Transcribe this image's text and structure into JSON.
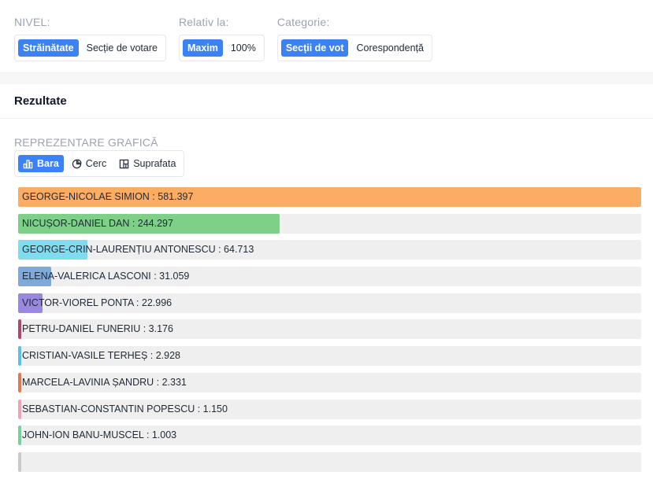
{
  "filters": [
    {
      "label": "NIVEL:",
      "options": [
        "Străinătate",
        "Secție de votare"
      ],
      "active": 0
    },
    {
      "label": "Relativ la:",
      "options": [
        "Maxim",
        "100%"
      ],
      "active": 0
    },
    {
      "label": "Categorie:",
      "options": [
        "Secții de vot",
        "Corespondență"
      ],
      "active": 0
    }
  ],
  "results": {
    "title": "Rezultate"
  },
  "viz": {
    "label": "REPREZENTARE GRAFICĂ",
    "options": [
      {
        "label": "Bara",
        "icon": "bar-chart-icon"
      },
      {
        "label": "Cerc",
        "icon": "pie-chart-icon"
      },
      {
        "label": "Suprafata",
        "icon": "treemap-icon"
      }
    ],
    "active": 0
  },
  "candidates": [
    {
      "label": "GEORGE-NICOLAE SIMION : 581.397",
      "votes": 581397,
      "color": "#fbad63"
    },
    {
      "label": "NICUȘOR-DANIEL DAN : 244.297",
      "votes": 244297,
      "color": "#7ecf87"
    },
    {
      "label": "GEORGE-CRIN-LAURENȚIU ANTONESCU : 64.713",
      "votes": 64713,
      "color": "#7fdcee"
    },
    {
      "label": "ELENA-VALERICA LASCONI : 31.059",
      "votes": 31059,
      "color": "#7fa9d8"
    },
    {
      "label": "VICTOR-VIOREL PONTA : 22.996",
      "votes": 22996,
      "color": "#9a87e0"
    },
    {
      "label": "PETRU-DANIEL FUNERIU : 3.176",
      "votes": 3176,
      "color": "#b0476b"
    },
    {
      "label": "CRISTIAN-VASILE TERHEȘ : 2.928",
      "votes": 2928,
      "color": "#5bc0e8"
    },
    {
      "label": "MARCELA-LAVINIA ȘANDRU : 2.331",
      "votes": 2331,
      "color": "#e07856"
    },
    {
      "label": "SEBASTIAN-CONSTANTIN POPESCU : 1.150",
      "votes": 1150,
      "color": "#f0a3b8"
    },
    {
      "label": "JOHN-ION BANU-MUSCEL : 1.003",
      "votes": 1003,
      "color": "#78d19a"
    },
    {
      "label": "",
      "votes": 800,
      "color": "#c9c9c9"
    }
  ],
  "max_votes": 581397
}
